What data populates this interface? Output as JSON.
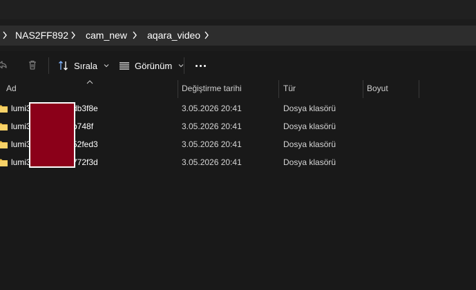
{
  "address": {
    "crumbs": [
      "NAS2FF892",
      "cam_new",
      "aqara_video"
    ]
  },
  "toolbar": {
    "share_icon": "share-icon",
    "delete_icon": "delete-icon",
    "sort_label": "Sırala",
    "view_label": "Görünüm",
    "more_icon": "more-options-icon"
  },
  "columns": {
    "name": "Ad",
    "modified": "Değiştirme tarihi",
    "type": "Tür",
    "size": "Boyut"
  },
  "files": [
    {
      "name_start": "lumi3",
      "name_end": "db3f8e",
      "modified": "3.05.2026 20:41",
      "type": "Dosya klasörü",
      "size": ""
    },
    {
      "name_start": "lumi3",
      "name_end": "b748f",
      "modified": "3.05.2026 20:41",
      "type": "Dosya klasörü",
      "size": ""
    },
    {
      "name_start": "lumi3",
      "name_end": "52fed3",
      "modified": "3.05.2026 20:41",
      "type": "Dosya klasörü",
      "size": ""
    },
    {
      "name_start": "lumi3",
      "name_end": "772f3d",
      "modified": "3.05.2026 20:41",
      "type": "Dosya klasörü",
      "size": ""
    }
  ],
  "colors": {
    "background": "#191919",
    "folder": "#f0c24a",
    "redaction": "#8b0019"
  }
}
